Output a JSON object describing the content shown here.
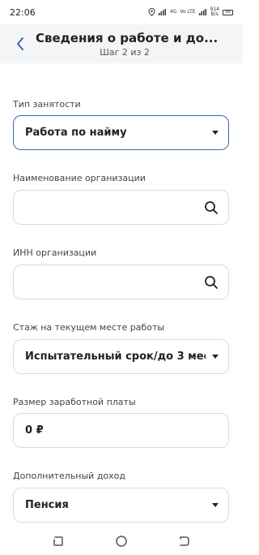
{
  "status_bar": {
    "time": "22:06",
    "network1": "4G",
    "volte": "Vo LTE",
    "speed_value": "914",
    "speed_unit": "B/s",
    "battery": "98"
  },
  "header": {
    "title": "Сведения о работе и до...",
    "subtitle": "Шаг 2 из 2"
  },
  "form": {
    "employment_type": {
      "label": "Тип занятости",
      "value": "Работа по найму"
    },
    "org_name": {
      "label": "Наименование организации",
      "value": ""
    },
    "org_inn": {
      "label": "ИНН организации",
      "value": ""
    },
    "experience": {
      "label": "Стаж на текущем месте работы",
      "value": "Испытательный срок/до 3 меся..."
    },
    "salary": {
      "label": "Размер заработной платы",
      "value": "0 ₽"
    },
    "extra_income": {
      "label": "Дополнительный доход",
      "value": "Пенсия"
    }
  },
  "colors": {
    "accent": "#3d6ba6",
    "header_bg": "#f4f5f6",
    "border": "#d8dadd"
  },
  "icons": [
    "back-arrow-icon",
    "search-icon",
    "chevron-down-icon",
    "location-icon",
    "recent-apps-icon",
    "home-icon",
    "back-nav-icon"
  ]
}
